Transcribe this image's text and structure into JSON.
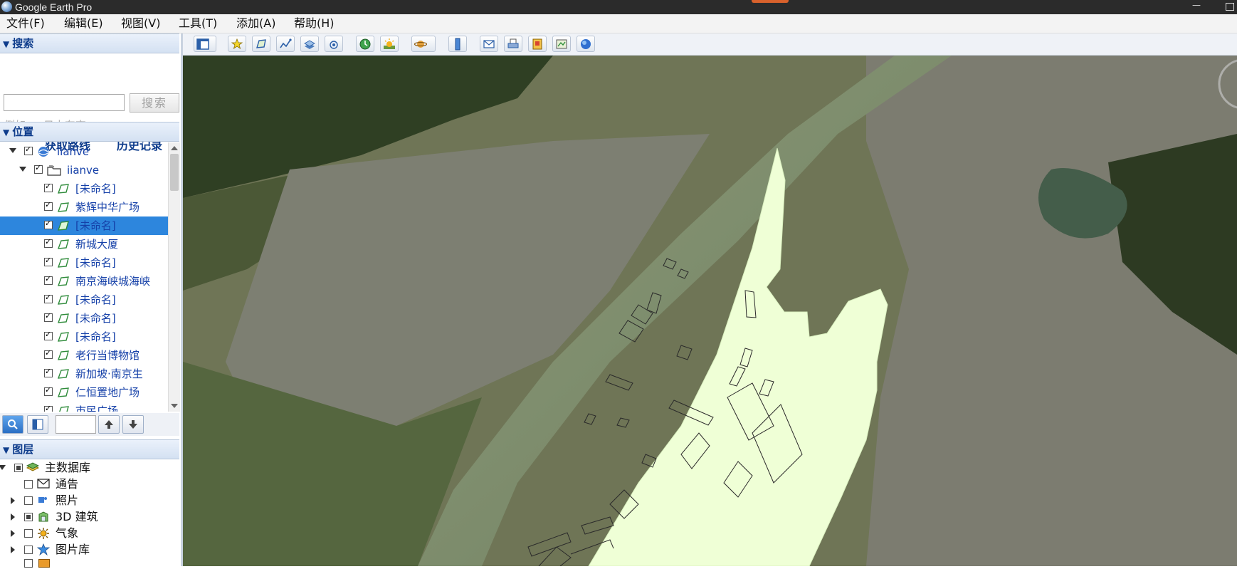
{
  "window": {
    "title": "Google Earth Pro"
  },
  "menu": [
    {
      "label": "文件(F)"
    },
    {
      "label": "编辑(E)"
    },
    {
      "label": "视图(V)"
    },
    {
      "label": "工具(T)"
    },
    {
      "label": "添加(A)"
    },
    {
      "label": "帮助(H)"
    }
  ],
  "toolbar": {
    "buttons": [
      {
        "icon": "sidebar-toggle-icon"
      },
      {
        "icon": "add-placemark-icon"
      },
      {
        "icon": "add-polygon-icon"
      },
      {
        "icon": "add-path-icon"
      },
      {
        "icon": "add-image-overlay-icon"
      },
      {
        "icon": "record-tour-icon"
      },
      {
        "icon": "historical-imagery-icon"
      },
      {
        "icon": "sunlight-icon"
      },
      {
        "icon": "planets-icon"
      },
      {
        "icon": "ruler-icon"
      },
      {
        "icon": "email-icon"
      },
      {
        "icon": "print-icon"
      },
      {
        "icon": "save-image-icon"
      },
      {
        "icon": "view-in-maps-icon"
      },
      {
        "icon": "earth-gallery-icon"
      }
    ]
  },
  "search": {
    "header": "搜索",
    "input_value": "",
    "button_label": "搜索",
    "hint": "例如：: 日本东京",
    "get_directions": "获取路线",
    "history": "历史记录"
  },
  "places": {
    "header": "位置",
    "root": "iianve",
    "folder": "iianve",
    "items": [
      {
        "label": "[未命名]",
        "checked": true,
        "selected": false
      },
      {
        "label": "紫辉中华广场",
        "checked": true,
        "selected": false
      },
      {
        "label": "[未命名]",
        "checked": true,
        "selected": true
      },
      {
        "label": "新城大厦",
        "checked": true,
        "selected": false
      },
      {
        "label": "[未命名]",
        "checked": true,
        "selected": false
      },
      {
        "label": "南京海峡城海峡",
        "checked": true,
        "selected": false
      },
      {
        "label": "[未命名]",
        "checked": true,
        "selected": false
      },
      {
        "label": "[未命名]",
        "checked": true,
        "selected": false
      },
      {
        "label": "[未命名]",
        "checked": true,
        "selected": false
      },
      {
        "label": "老行当博物馆",
        "checked": true,
        "selected": false
      },
      {
        "label": "新加坡·南京生",
        "checked": true,
        "selected": false
      },
      {
        "label": "仁恒置地广场",
        "checked": true,
        "selected": false
      },
      {
        "label": "市民广场",
        "checked": true,
        "selected": false
      }
    ]
  },
  "layers": {
    "header": "图层",
    "items": [
      {
        "label": "主数据库"
      },
      {
        "label": "通告"
      },
      {
        "label": "照片"
      },
      {
        "label": "3D 建筑"
      },
      {
        "label": "气象"
      },
      {
        "label": "图片库"
      }
    ]
  }
}
